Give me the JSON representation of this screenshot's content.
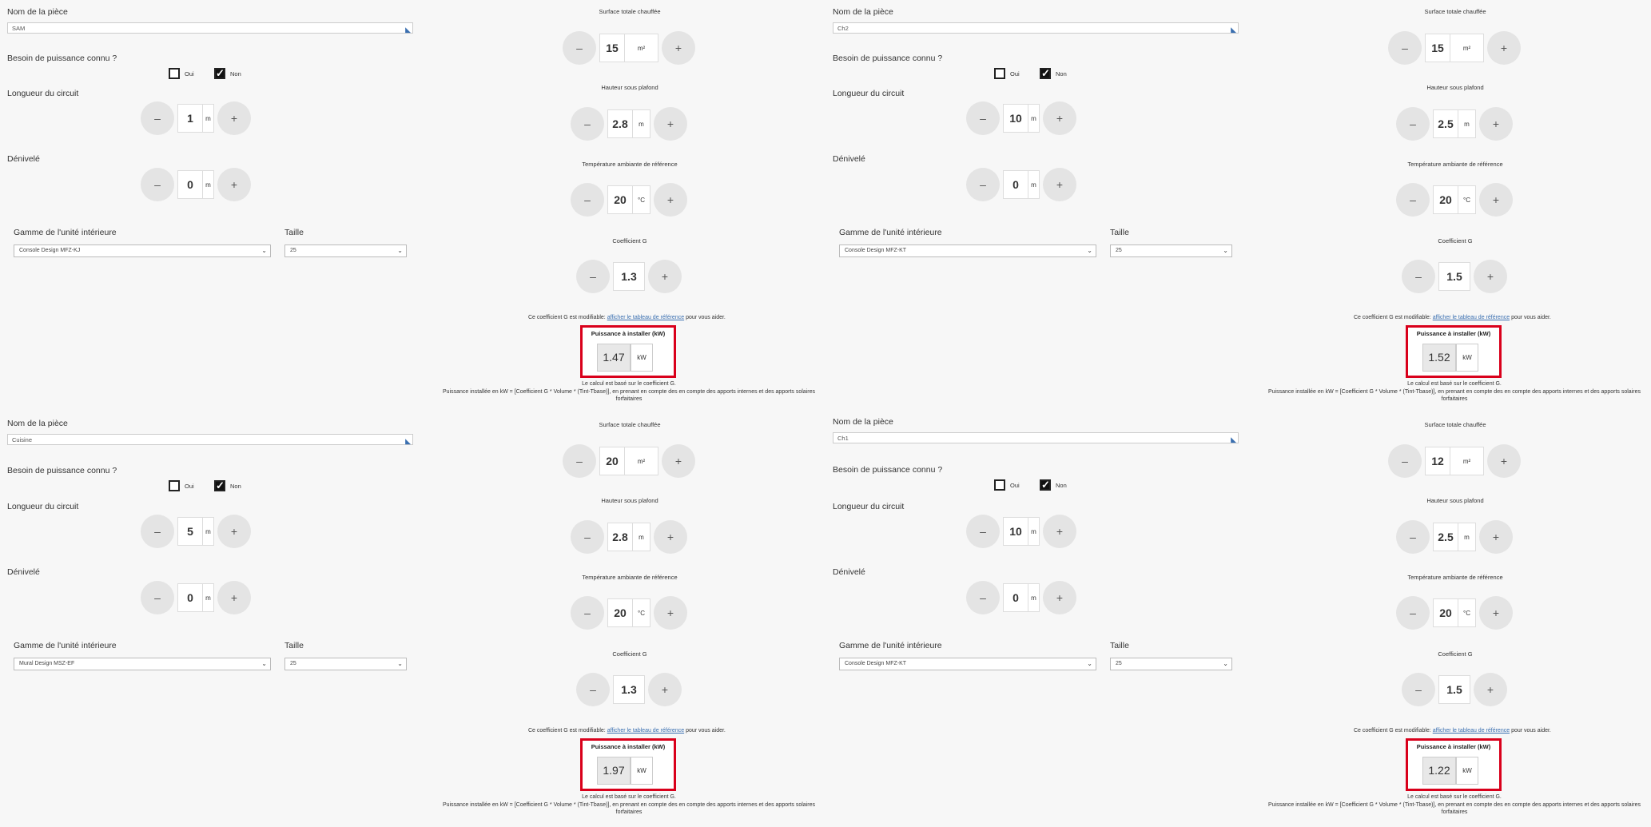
{
  "labels": {
    "room_name": "Nom de la pièce",
    "power_known": "Besoin de puissance connu ?",
    "yes": "Oui",
    "no": "Non",
    "circuit_length": "Longueur du circuit",
    "elevation": "Dénivelé",
    "range": "Gamme de l'unité intérieure",
    "size": "Taille",
    "surface": "Surface totale chauffée",
    "height": "Hauteur sous plafond",
    "temperature": "Température ambiante de référence",
    "coef": "Coefficient G",
    "note_prefix": "Ce coefficient G est modifiable:",
    "note_link": "afficher le tableau de référence",
    "note_suffix": "pour vous aider.",
    "power_title": "Puissance à installer (kW)",
    "power_unit": "kW",
    "calc_based": "Le calcul est basé sur le coefficient G.",
    "formula": "Puissance installée en kW = [Coefficient G * Volume * (Tint-Tbase)], en prenant en compte des en compte des apports internes et des apports solaires forfaitaires",
    "minus": "–",
    "plus": "+",
    "unit_m": "m",
    "unit_m2": "m²",
    "unit_c": "°C"
  },
  "rooms": [
    {
      "name": "SAM",
      "length": "1",
      "elevation": "0",
      "range": "Console Design MFZ-KJ",
      "size": "25",
      "surface": "15",
      "height": "2.8",
      "temp": "20",
      "coef": "1.3",
      "power": "1.47"
    },
    {
      "name": "Ch2",
      "length": "10",
      "elevation": "0",
      "range": "Console Design MFZ-KT",
      "size": "25",
      "surface": "15",
      "height": "2.5",
      "temp": "20",
      "coef": "1.5",
      "power": "1.52"
    },
    {
      "name": "Cuisine",
      "length": "5",
      "elevation": "0",
      "range": "Mural Design MSZ-EF",
      "size": "25",
      "surface": "20",
      "height": "2.8",
      "temp": "20",
      "coef": "1.3",
      "power": "1.97"
    },
    {
      "name": "Ch1",
      "length": "10",
      "elevation": "0",
      "range": "Console Design MFZ-KT",
      "size": "25",
      "surface": "12",
      "height": "2.5",
      "temp": "20",
      "coef": "1.5",
      "power": "1.22"
    }
  ]
}
